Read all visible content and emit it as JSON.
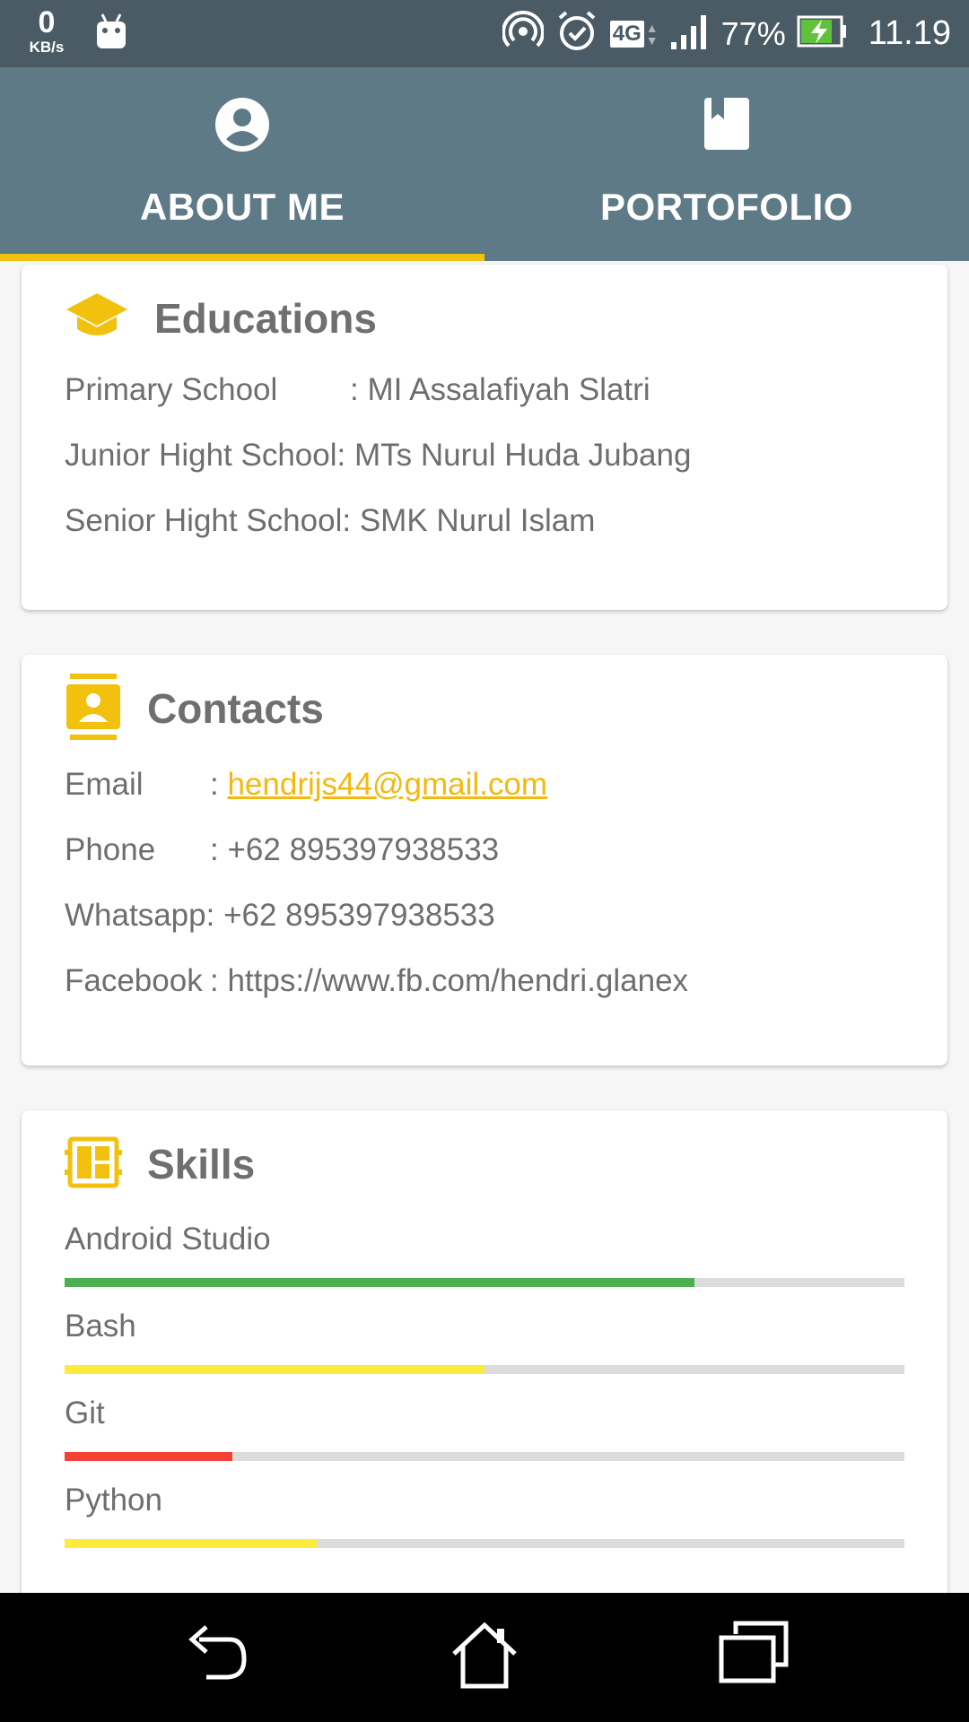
{
  "status_bar": {
    "speed_value": "0",
    "speed_unit": "KB/s",
    "network": "4G",
    "battery": "77%",
    "time": "11.19"
  },
  "tabs": [
    {
      "label": "ABOUT ME",
      "icon": "account-circle-icon",
      "active": true
    },
    {
      "label": "PORTOFOLIO",
      "icon": "book-icon",
      "active": false
    }
  ],
  "educations": {
    "title": "Educations",
    "rows": [
      {
        "label": "Primary School",
        "sep": ":",
        "value": "MI Assalafiyah Slatri"
      },
      {
        "label": "Junior Hight School",
        "sep": ":",
        "value": "MTs Nurul Huda Jubang"
      },
      {
        "label": "Senior Hight School",
        "sep": ":",
        "value": "SMK Nurul Islam"
      }
    ]
  },
  "contacts": {
    "title": "Contacts",
    "rows": [
      {
        "label": "Email",
        "sep": ":",
        "value": "hendrijs44@gmail.com"
      },
      {
        "label": "Phone",
        "sep": ":",
        "value": "+62 895397938533"
      },
      {
        "label": "Whatsapp",
        "sep": ":",
        "value": "+62 895397938533"
      },
      {
        "label": "Facebook",
        "sep": ":",
        "value": "https://www.fb.com/hendri.glanex"
      }
    ]
  },
  "skills": {
    "title": "Skills",
    "items": [
      {
        "name": "Android Studio",
        "level": 0.75,
        "color": "#4caf50"
      },
      {
        "name": "Bash",
        "level": 0.5,
        "color": "#ffeb3b"
      },
      {
        "name": "Git",
        "level": 0.2,
        "color": "#f44336"
      },
      {
        "name": "Python",
        "level": 0.3,
        "color": "#ffeb3b"
      }
    ]
  },
  "colors": {
    "accent": "#f2c10e",
    "tabbar": "#5f7a87",
    "statusbar": "#4a5b66"
  }
}
